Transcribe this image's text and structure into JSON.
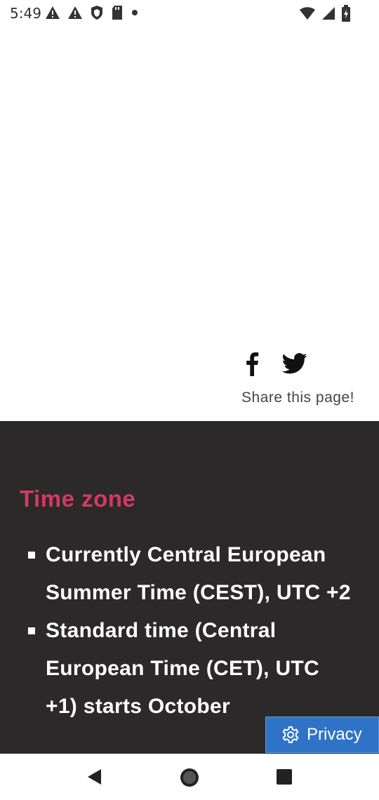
{
  "status_bar": {
    "time": "5:49",
    "left_icons": [
      "warning-icon",
      "warning-icon",
      "shield-icon",
      "sd-card-icon",
      "dot-icon"
    ],
    "right_icons": [
      "wifi-icon",
      "signal-icon",
      "battery-icon"
    ]
  },
  "share": {
    "icons": [
      "facebook-icon",
      "twitter-icon"
    ],
    "label": "Share this page!"
  },
  "time_zone": {
    "title": "Time zone",
    "items": [
      "Currently Central European Summer Time (CEST), UTC +2",
      "Standard time (Central European Time (CET), UTC +1) starts October"
    ]
  },
  "privacy": {
    "label": "Privacy",
    "icon": "gear-icon"
  },
  "nav_bar": {
    "icons": [
      "back-icon",
      "home-icon",
      "recent-apps-icon"
    ]
  },
  "colors": {
    "dark_background": "#2b2929",
    "accent": "#d23a63",
    "privacy_button": "#2f73c7"
  }
}
